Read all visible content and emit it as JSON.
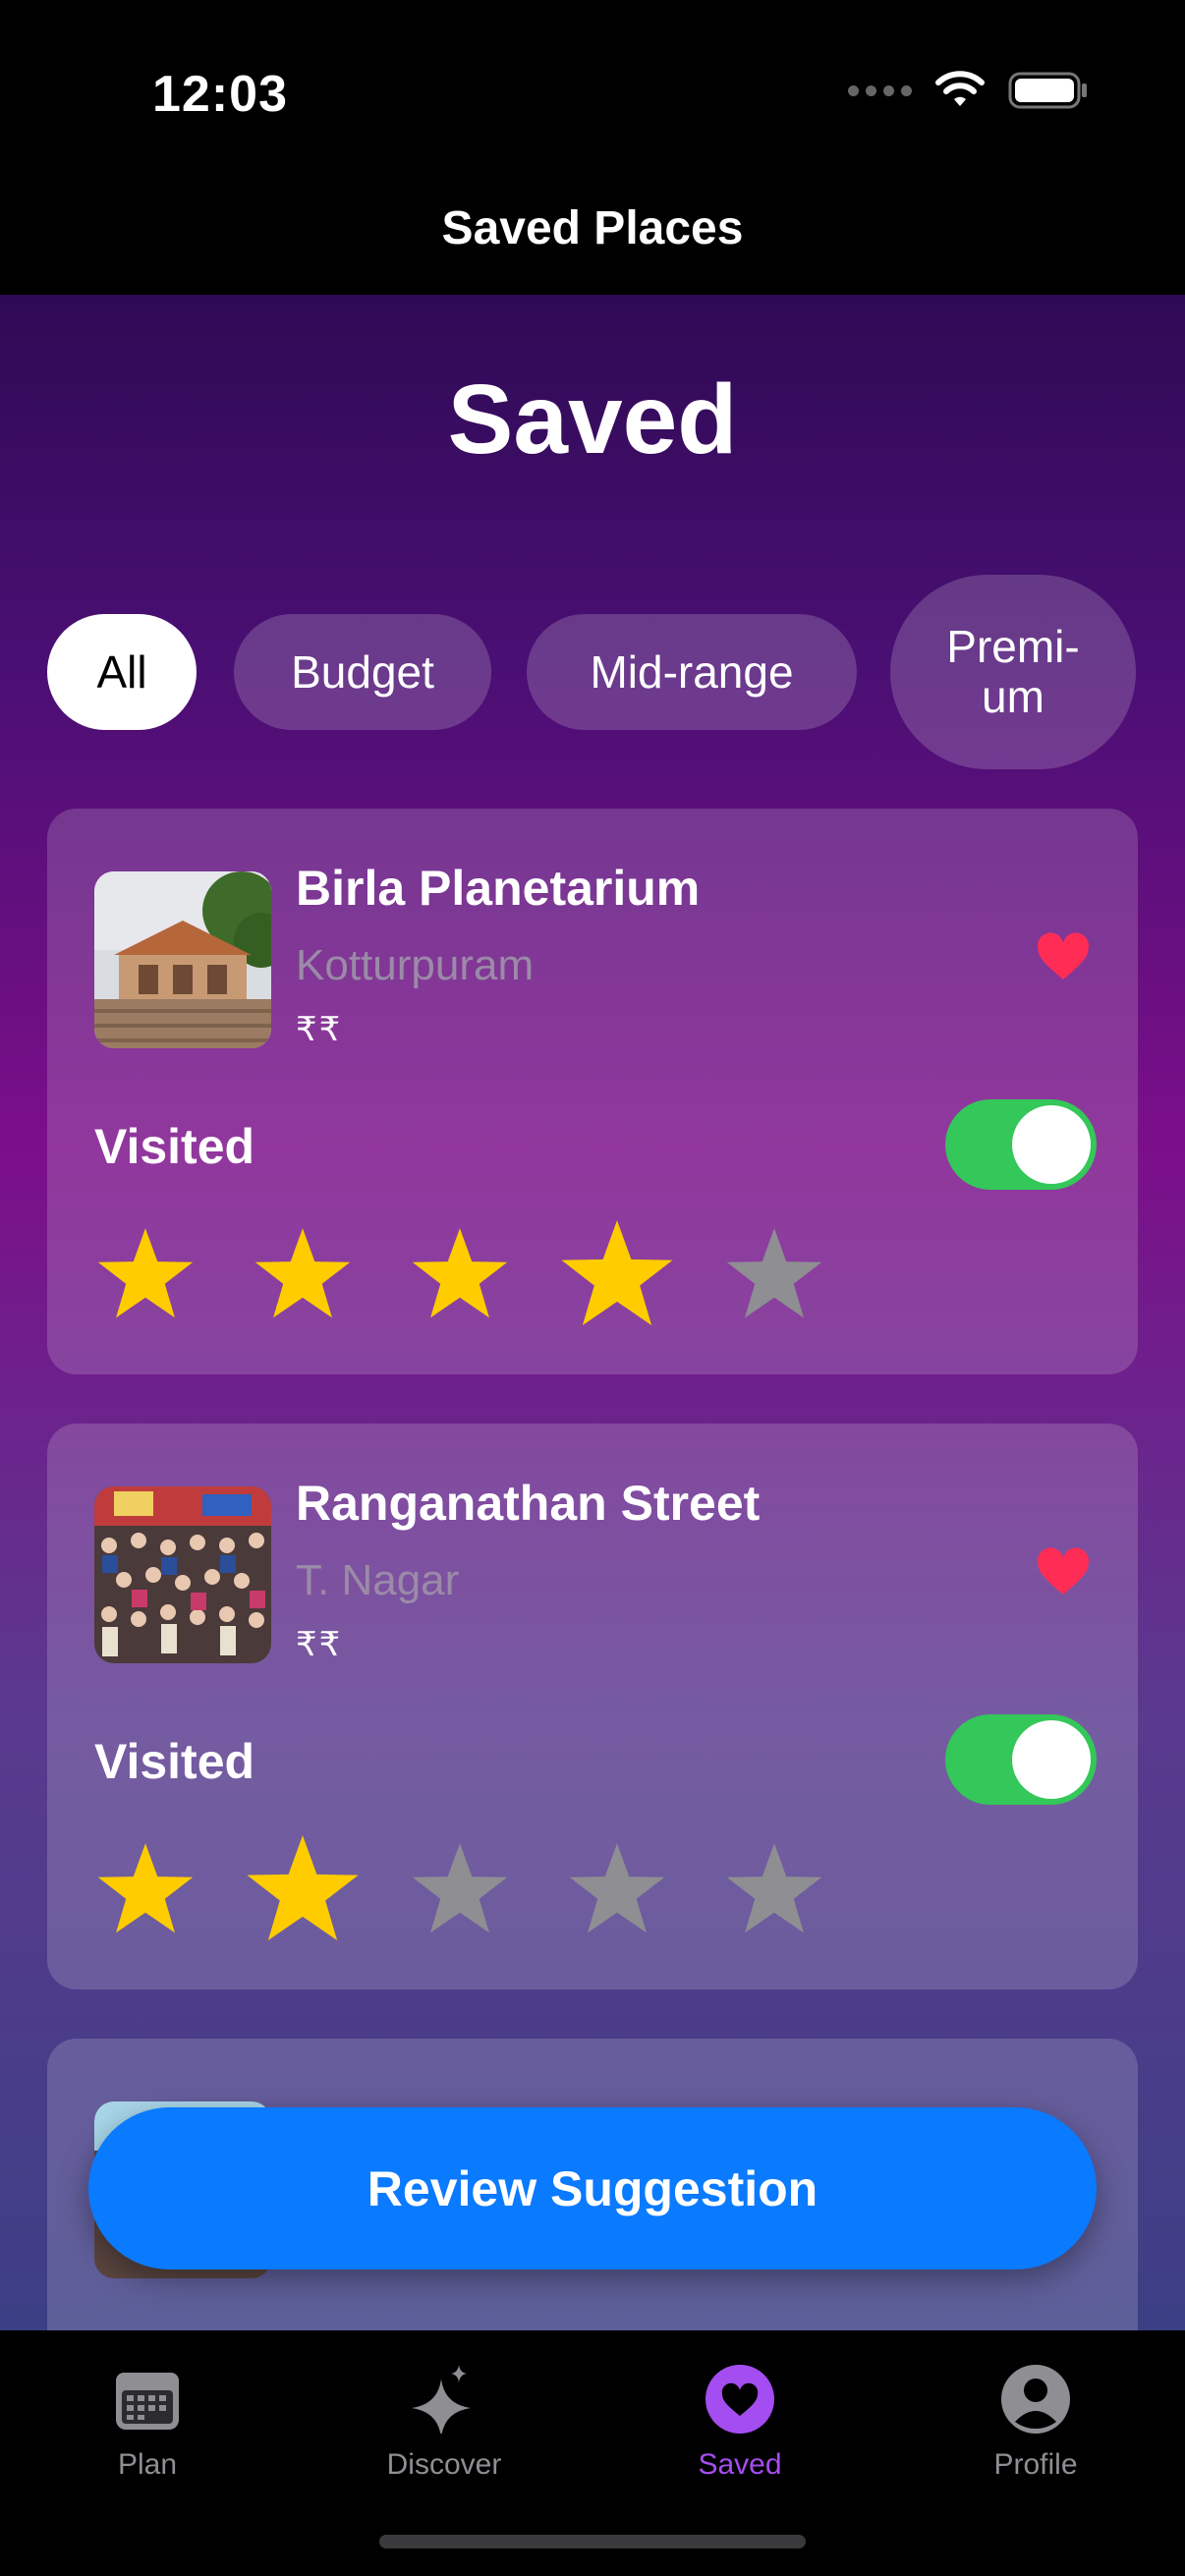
{
  "status_bar": {
    "time": "12:03"
  },
  "navigation": {
    "title": "Saved Places"
  },
  "page": {
    "heading": "Saved"
  },
  "filters": [
    {
      "label": "All",
      "active": true
    },
    {
      "label": "Budget",
      "active": false
    },
    {
      "label": "Mid-range",
      "active": false
    },
    {
      "label": "Premi-\num",
      "active": false
    }
  ],
  "places": [
    {
      "name": "Birla Planetarium",
      "area": "Kotturpuram",
      "price": "₹₹",
      "favorite": true,
      "visited_label": "Visited",
      "visited": true,
      "rating": 4,
      "max_rating": 5
    },
    {
      "name": "Ranganathan Street",
      "area": "T. Nagar",
      "price": "₹₹",
      "favorite": true,
      "visited_label": "Visited",
      "visited": true,
      "rating": 2,
      "max_rating": 5
    },
    {
      "name": "",
      "area": "",
      "price": "",
      "favorite": true,
      "partially_hidden": true
    }
  ],
  "actions": {
    "review_button": "Review Suggestion"
  },
  "tab_bar": {
    "tabs": [
      {
        "label": "Plan",
        "icon": "calendar-icon",
        "active": false
      },
      {
        "label": "Discover",
        "icon": "sparkles-icon",
        "active": false
      },
      {
        "label": "Saved",
        "icon": "heart-icon",
        "active": true
      },
      {
        "label": "Profile",
        "icon": "person-icon",
        "active": false
      }
    ]
  },
  "colors": {
    "accent": "#a44df0",
    "toggle_on": "#34c759",
    "star_filled": "#ffcc00",
    "star_empty": "#8e8e93",
    "heart": "#ff2d55",
    "primary_button": "#0a7aff"
  }
}
